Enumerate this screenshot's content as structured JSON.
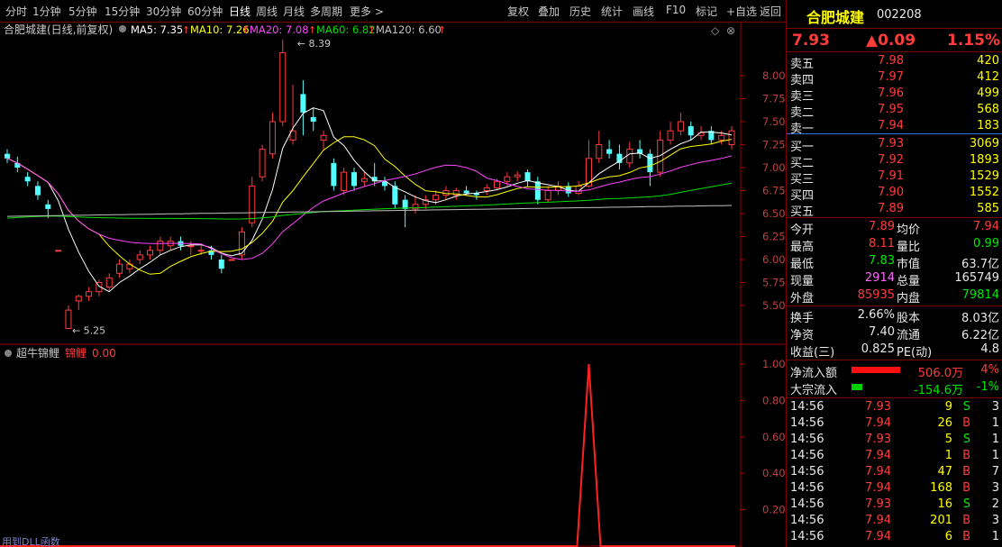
{
  "toolbar": {
    "periods": [
      "分时",
      "1分钟",
      "5分钟",
      "15分钟",
      "30分钟",
      "60分钟",
      "日线",
      "周线",
      "月线",
      "多周期",
      "更多 >"
    ],
    "active_period": "日线",
    "actions": [
      "复权",
      "叠加",
      "历史",
      "统计",
      "画线",
      "F10",
      "标记",
      "+自选",
      "返回"
    ]
  },
  "main_chart": {
    "stock_label": "合肥城建(日线,前复权)",
    "ma": [
      {
        "label": "MA5: 7.35",
        "color": "#ffffff"
      },
      {
        "label": "MA10: 7.26",
        "color": "#ffff00"
      },
      {
        "label": "MA20: 7.08",
        "color": "#ff44ff"
      },
      {
        "label": "MA60: 6.82",
        "color": "#00dd00"
      },
      {
        "label": "MA120: 6.60",
        "color": "#c0c0c0"
      }
    ],
    "high_label": "8.39",
    "low_label": "5.25",
    "y_ticks": [
      "8.00",
      "7.75",
      "7.50",
      "7.25",
      "7.00",
      "6.75",
      "6.50",
      "6.25",
      "6.00",
      "5.75",
      "5.50"
    ]
  },
  "chart_data": {
    "type": "candlestick",
    "y_ticks": [
      8.0,
      7.75,
      7.5,
      7.25,
      7.0,
      6.75,
      6.5,
      6.25,
      6.0,
      5.75,
      5.5
    ],
    "high": 8.39,
    "low": 5.25,
    "candles": [
      [
        7.15,
        7.1,
        7.2,
        7.05
      ],
      [
        7.05,
        7.0,
        7.12,
        6.95
      ],
      [
        6.9,
        6.85,
        6.95,
        6.8
      ],
      [
        6.8,
        6.7,
        6.85,
        6.65
      ],
      [
        6.6,
        6.55,
        6.65,
        6.45
      ],
      [
        6.1,
        6.1,
        6.1,
        6.1
      ],
      [
        5.25,
        5.45,
        5.5,
        5.25
      ],
      [
        5.55,
        5.6,
        5.62,
        5.45
      ],
      [
        5.6,
        5.65,
        5.7,
        5.55
      ],
      [
        5.65,
        5.75,
        5.78,
        5.6
      ],
      [
        5.7,
        5.8,
        5.85,
        5.65
      ],
      [
        5.85,
        5.95,
        6.0,
        5.8
      ],
      [
        5.9,
        5.95,
        6.0,
        5.85
      ],
      [
        6.0,
        6.05,
        6.1,
        5.95
      ],
      [
        6.05,
        6.1,
        6.15,
        6.0
      ],
      [
        6.1,
        6.2,
        6.25,
        6.05
      ],
      [
        6.15,
        6.2,
        6.25,
        6.1
      ],
      [
        6.2,
        6.15,
        6.25,
        6.1
      ],
      [
        6.15,
        6.15,
        6.2,
        6.05
      ],
      [
        6.1,
        6.1,
        6.15,
        6.05
      ],
      [
        6.1,
        6.05,
        6.15,
        6.0
      ],
      [
        6.0,
        5.9,
        6.05,
        5.85
      ],
      [
        6.0,
        6.0,
        6.0,
        6.0
      ],
      [
        6.05,
        6.3,
        6.35,
        6.0
      ],
      [
        6.4,
        6.8,
        6.9,
        6.35
      ],
      [
        6.9,
        7.2,
        7.25,
        6.85
      ],
      [
        7.15,
        7.5,
        7.6,
        7.1
      ],
      [
        7.5,
        8.25,
        8.39,
        7.45
      ],
      [
        7.3,
        7.4,
        7.9,
        7.25
      ],
      [
        7.8,
        7.6,
        7.95,
        7.35
      ],
      [
        7.55,
        7.5,
        7.65,
        7.4
      ],
      [
        7.3,
        7.35,
        7.4,
        7.2
      ],
      [
        7.05,
        6.8,
        7.1,
        6.75
      ],
      [
        6.75,
        6.95,
        7.0,
        6.7
      ],
      [
        6.95,
        6.8,
        7.0,
        6.75
      ],
      [
        6.85,
        6.88,
        6.95,
        6.8
      ],
      [
        6.9,
        6.85,
        7.05,
        6.8
      ],
      [
        6.85,
        6.8,
        6.9,
        6.75
      ],
      [
        6.8,
        6.6,
        6.85,
        6.55
      ],
      [
        6.65,
        6.55,
        6.7,
        6.35
      ],
      [
        6.55,
        6.6,
        6.7,
        6.5
      ],
      [
        6.6,
        6.65,
        6.7,
        6.55
      ],
      [
        6.65,
        6.7,
        6.75,
        6.6
      ],
      [
        6.7,
        6.75,
        6.8,
        6.65
      ],
      [
        6.7,
        6.75,
        6.78,
        6.65
      ],
      [
        6.75,
        6.72,
        6.8,
        6.7
      ],
      [
        6.72,
        6.7,
        6.75,
        6.65
      ],
      [
        6.75,
        6.78,
        6.82,
        6.7
      ],
      [
        6.78,
        6.85,
        6.88,
        6.75
      ],
      [
        6.85,
        6.9,
        6.95,
        6.8
      ],
      [
        6.9,
        6.92,
        6.96,
        6.85
      ],
      [
        6.95,
        6.85,
        6.98,
        6.8
      ],
      [
        6.85,
        6.65,
        6.9,
        6.6
      ],
      [
        6.65,
        6.75,
        6.8,
        6.62
      ],
      [
        6.75,
        6.8,
        6.85,
        6.7
      ],
      [
        6.8,
        6.72,
        6.84,
        6.68
      ],
      [
        6.72,
        6.8,
        6.85,
        6.7
      ],
      [
        6.8,
        7.1,
        7.3,
        6.78
      ],
      [
        7.1,
        7.25,
        7.4,
        7.05
      ],
      [
        7.2,
        7.15,
        7.3,
        7.1
      ],
      [
        7.15,
        7.05,
        7.25,
        6.98
      ],
      [
        7.05,
        7.2,
        7.28,
        7.0
      ],
      [
        7.2,
        7.15,
        7.3,
        7.1
      ],
      [
        7.15,
        6.95,
        7.2,
        6.8
      ],
      [
        6.95,
        7.3,
        7.4,
        6.9
      ],
      [
        7.3,
        7.4,
        7.5,
        7.25
      ],
      [
        7.4,
        7.5,
        7.6,
        7.35
      ],
      [
        7.45,
        7.35,
        7.5,
        7.3
      ],
      [
        7.35,
        7.38,
        7.45,
        7.3
      ],
      [
        7.4,
        7.3,
        7.45,
        7.25
      ],
      [
        7.3,
        7.35,
        7.4,
        7.25
      ],
      [
        7.25,
        7.4,
        7.45,
        7.2
      ]
    ],
    "indicator": {
      "name": "超牛锦鲤",
      "series": "锦鲤",
      "value": "0.00",
      "y_ticks": [
        1.0,
        0.8,
        0.6,
        0.4,
        0.2
      ],
      "ylim": [
        0,
        1
      ],
      "spike_index": 57,
      "spike_value": 1.0
    }
  },
  "indicator_panel": {
    "name": "超牛锦鲤",
    "series_label": "锦鲤",
    "value": "0.00",
    "y_ticks": [
      "1.00",
      "0.80",
      "0.60",
      "0.40",
      "0.20"
    ],
    "footer_note": "用到DLL函数"
  },
  "quote": {
    "name": "合肥城建",
    "code": "002208",
    "price": "7.93",
    "change": "▲0.09",
    "change_pct": "1.15%",
    "asks": [
      {
        "label": "卖五",
        "price": "7.98",
        "vol": "420"
      },
      {
        "label": "卖四",
        "price": "7.97",
        "vol": "412"
      },
      {
        "label": "卖三",
        "price": "7.96",
        "vol": "499"
      },
      {
        "label": "卖二",
        "price": "7.95",
        "vol": "568"
      },
      {
        "label": "卖一",
        "price": "7.94",
        "vol": "183"
      }
    ],
    "bids": [
      {
        "label": "买一",
        "price": "7.93",
        "vol": "3069"
      },
      {
        "label": "买二",
        "price": "7.92",
        "vol": "1893"
      },
      {
        "label": "买三",
        "price": "7.91",
        "vol": "1529"
      },
      {
        "label": "买四",
        "price": "7.90",
        "vol": "1552"
      },
      {
        "label": "买五",
        "price": "7.89",
        "vol": "585"
      }
    ],
    "stats": [
      {
        "l1": "今开",
        "v1": "7.89",
        "c1": "red",
        "l2": "均价",
        "v2": "7.94",
        "c2": "red"
      },
      {
        "l1": "最高",
        "v1": "8.11",
        "c1": "red",
        "l2": "量比",
        "v2": "0.99",
        "c2": "green"
      },
      {
        "l1": "最低",
        "v1": "7.83",
        "c1": "green",
        "l2": "市值",
        "v2": "63.7亿",
        "c2": "white"
      },
      {
        "l1": "现量",
        "v1": "2914",
        "c1": "purple",
        "l2": "总量",
        "v2": "165749",
        "c2": "white"
      },
      {
        "l1": "外盘",
        "v1": "85935",
        "c1": "red",
        "l2": "内盘",
        "v2": "79814",
        "c2": "green"
      }
    ],
    "fund": [
      {
        "l1": "换手",
        "v1": "2.66%",
        "l2": "股本",
        "v2": "8.03亿"
      },
      {
        "l1": "净资",
        "v1": "7.40",
        "l2": "流通",
        "v2": "6.22亿"
      },
      {
        "l1": "收益(三)",
        "v1": "0.825",
        "l2": "PE(动)",
        "v2": "4.8"
      }
    ],
    "flows": [
      {
        "label": "净流入额",
        "value": "506.0万",
        "pct": "4%",
        "color": "red",
        "bar": 0.9
      },
      {
        "label": "大宗流入",
        "value": "-154.6万",
        "pct": "-1%",
        "color": "green",
        "bar": 0.2
      }
    ],
    "ticks": [
      {
        "time": "14:56",
        "price": "7.93",
        "vol": "9",
        "side": "S",
        "n": "3"
      },
      {
        "time": "14:56",
        "price": "7.94",
        "vol": "26",
        "side": "B",
        "n": "1"
      },
      {
        "time": "14:56",
        "price": "7.93",
        "vol": "5",
        "side": "S",
        "n": "1"
      },
      {
        "time": "14:56",
        "price": "7.94",
        "vol": "1",
        "side": "B",
        "n": "1"
      },
      {
        "time": "14:56",
        "price": "7.94",
        "vol": "47",
        "side": "B",
        "n": "7"
      },
      {
        "time": "14:56",
        "price": "7.94",
        "vol": "168",
        "side": "B",
        "n": "3"
      },
      {
        "time": "14:56",
        "price": "7.93",
        "vol": "16",
        "side": "S",
        "n": "2"
      },
      {
        "time": "14:56",
        "price": "7.94",
        "vol": "201",
        "side": "B",
        "n": "3"
      },
      {
        "time": "14:56",
        "price": "7.94",
        "vol": "6",
        "side": "B",
        "n": "1"
      }
    ]
  }
}
